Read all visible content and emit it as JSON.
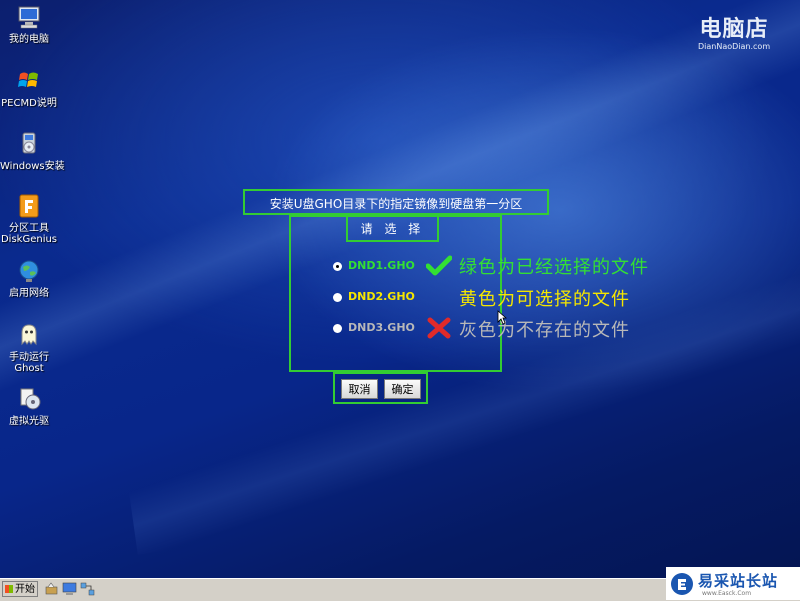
{
  "desktop": {
    "icons": [
      {
        "label": "我的电脑",
        "icon": "computer-icon"
      },
      {
        "label": "PECMD说明",
        "icon": "windows-flag-icon"
      },
      {
        "label": "Windows安装",
        "icon": "install-icon"
      },
      {
        "label": "分区工具",
        "label2": "DiskGenius",
        "icon": "diskgenius-icon"
      },
      {
        "label": "启用网络",
        "icon": "network-globe-icon"
      },
      {
        "label": "手动运行",
        "label2": "Ghost",
        "icon": "ghost-icon"
      },
      {
        "label": "虚拟光驱",
        "icon": "virtual-drive-icon"
      }
    ]
  },
  "brand": {
    "name": "电脑店",
    "url": "DianNaoDian.com"
  },
  "dialog": {
    "title": "安装U盘GHO目录下的指定镜像到硬盘第一分区",
    "prompt": "请 选 择",
    "options": [
      {
        "name": "DND1.GHO",
        "color": "#33e033",
        "selected": true,
        "mark": "check-icon"
      },
      {
        "name": "DND2.GHO",
        "color": "#f5e600",
        "selected": false,
        "mark": ""
      },
      {
        "name": "DND3.GHO",
        "color": "#b8b8b8",
        "selected": false,
        "mark": "cross-icon"
      }
    ],
    "cancel_label": "取消",
    "ok_label": "确定"
  },
  "legend": {
    "green_text": "绿色为已经选择的文件",
    "yellow_text": "黄色为可选择的文件",
    "gray_text": "灰色为不存在的文件",
    "green_color": "#33e033",
    "yellow_color": "#f5e600",
    "gray_color": "#b8b8b8"
  },
  "taskbar": {
    "start_label": "开始"
  },
  "watermark": {
    "text": "易采站长站",
    "sub": "www.Easck.Com"
  },
  "colors": {
    "frame": "#33cc33"
  }
}
